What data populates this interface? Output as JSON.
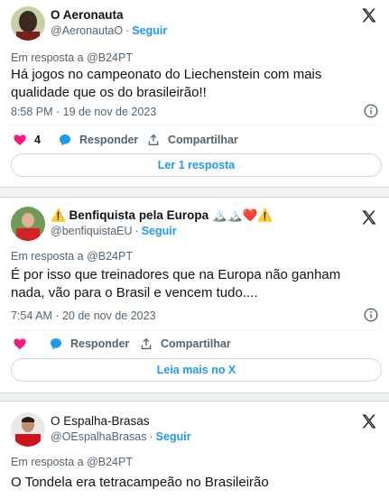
{
  "colors": {
    "accent": "#1d9bf0",
    "secondary_text": "#536471",
    "like": "#f91880",
    "border": "#cfd9de"
  },
  "tweets": [
    {
      "author": "O Aeronauta",
      "handle": "@AeronautaO",
      "follow_label": "Seguir",
      "reply_to": "Em resposta a @B24PT",
      "text": "Há jogos no campeonato do Liechenstein com mais qualidade que os do brasileirão!!",
      "timestamp": "8:58 PM · 19 de nov de 2023",
      "likes": "4",
      "reply_label": "Responder",
      "share_label": "Compartilhar",
      "more_label": "Ler 1 resposta"
    },
    {
      "author": "⚠️ Benfiquista pela Europa 🏔️🏔️❤️⚠️",
      "handle": "@benfiquistaEU",
      "follow_label": "Seguir",
      "reply_to": "Em resposta a @B24PT",
      "text": "É por isso que treinadores que na Europa não ganham nada, vão para o Brasil e vencem tudo....",
      "timestamp": "7:54 AM · 20 de nov de 2023",
      "likes": "",
      "reply_label": "Responder",
      "share_label": "Compartilhar",
      "more_label": "Leia mais no X"
    },
    {
      "author": "O Espalha-Brasas",
      "handle": "@OEspalhaBrasas",
      "follow_label": "Seguir",
      "reply_to": "Em resposta a @B24PT",
      "text": "O Tondela era tetracampeão no Brasileirão"
    }
  ],
  "icons": {
    "x_logo": "x-logo-icon",
    "info": "info-icon",
    "heart": "heart-icon",
    "reply": "reply-bubble-icon",
    "share": "share-icon"
  }
}
